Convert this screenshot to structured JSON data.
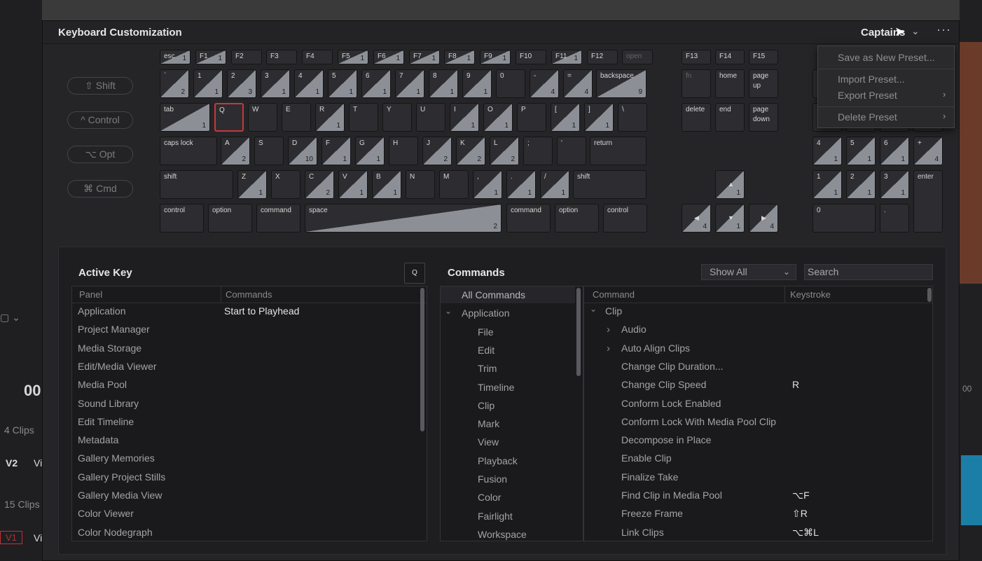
{
  "window": {
    "title": "Keyboard Customization",
    "preset": "Captains",
    "more": "···"
  },
  "modifiers": [
    "⇧ Shift",
    "^ Control",
    "⌥ Opt",
    "⌘ Cmd"
  ],
  "keyboard": {
    "row_fn": [
      {
        "label": "esc",
        "count": "1"
      },
      {
        "label": "F1",
        "count": "1"
      },
      {
        "label": "F2",
        "count": ""
      },
      {
        "label": "F3",
        "count": ""
      },
      {
        "label": "F4",
        "count": ""
      },
      {
        "label": "F5",
        "count": "1"
      },
      {
        "label": "F6",
        "count": "1"
      },
      {
        "label": "F7",
        "count": "1"
      },
      {
        "label": "F8",
        "count": "1"
      },
      {
        "label": "F9",
        "count": "1"
      },
      {
        "label": "F10",
        "count": ""
      },
      {
        "label": "F11",
        "count": "1"
      },
      {
        "label": "F12",
        "count": ""
      },
      {
        "label": "open",
        "count": ""
      }
    ],
    "row_num": [
      {
        "label": "`",
        "count": "2"
      },
      {
        "label": "1",
        "count": "1"
      },
      {
        "label": "2",
        "count": "3"
      },
      {
        "label": "3",
        "count": "1"
      },
      {
        "label": "4",
        "count": "1"
      },
      {
        "label": "5",
        "count": "1"
      },
      {
        "label": "6",
        "count": "1"
      },
      {
        "label": "7",
        "count": "1"
      },
      {
        "label": "8",
        "count": "1"
      },
      {
        "label": "9",
        "count": "1"
      },
      {
        "label": "0",
        "count": ""
      },
      {
        "label": "-",
        "count": "4"
      },
      {
        "label": "=",
        "count": "4"
      },
      {
        "label": "backspace",
        "count": "9"
      }
    ],
    "row_tab": [
      {
        "label": "tab",
        "count": "1"
      },
      {
        "label": "Q",
        "count": ""
      },
      {
        "label": "W",
        "count": ""
      },
      {
        "label": "E",
        "count": ""
      },
      {
        "label": "R",
        "count": "1"
      },
      {
        "label": "T",
        "count": ""
      },
      {
        "label": "Y",
        "count": ""
      },
      {
        "label": "U",
        "count": ""
      },
      {
        "label": "I",
        "count": "1"
      },
      {
        "label": "O",
        "count": "1"
      },
      {
        "label": "P",
        "count": ""
      },
      {
        "label": "[",
        "count": "1"
      },
      {
        "label": "]",
        "count": "1"
      },
      {
        "label": "\\",
        "count": ""
      }
    ],
    "row_caps": [
      {
        "label": "caps lock",
        "count": ""
      },
      {
        "label": "A",
        "count": "2"
      },
      {
        "label": "S",
        "count": ""
      },
      {
        "label": "D",
        "count": "10"
      },
      {
        "label": "F",
        "count": "1"
      },
      {
        "label": "G",
        "count": "1"
      },
      {
        "label": "H",
        "count": ""
      },
      {
        "label": "J",
        "count": "2"
      },
      {
        "label": "K",
        "count": "2"
      },
      {
        "label": "L",
        "count": "2"
      },
      {
        "label": ";",
        "count": ""
      },
      {
        "label": "'",
        "count": ""
      },
      {
        "label": "return",
        "count": ""
      }
    ],
    "row_shift": [
      {
        "label": "shift",
        "count": ""
      },
      {
        "label": "Z",
        "count": "1"
      },
      {
        "label": "X",
        "count": ""
      },
      {
        "label": "C",
        "count": "2"
      },
      {
        "label": "V",
        "count": "1"
      },
      {
        "label": "B",
        "count": "1"
      },
      {
        "label": "N",
        "count": ""
      },
      {
        "label": "M",
        "count": ""
      },
      {
        "label": ",",
        "count": "1"
      },
      {
        "label": ".",
        "count": "1"
      },
      {
        "label": "/",
        "count": "1"
      },
      {
        "label": "shift",
        "count": ""
      }
    ],
    "row_bottom": [
      {
        "label": "control",
        "count": ""
      },
      {
        "label": "option",
        "count": ""
      },
      {
        "label": "command",
        "count": ""
      },
      {
        "label": "space",
        "count": "2"
      },
      {
        "label": "command",
        "count": ""
      },
      {
        "label": "option",
        "count": ""
      },
      {
        "label": "control",
        "count": ""
      }
    ],
    "nav_fn": [
      {
        "label": "F13",
        "count": ""
      },
      {
        "label": "F14",
        "count": ""
      },
      {
        "label": "F15",
        "count": ""
      }
    ],
    "nav_1": [
      {
        "label": "fn",
        "count": ""
      },
      {
        "label": "home",
        "count": ""
      },
      {
        "label": "page up",
        "count": ""
      }
    ],
    "nav_2": [
      {
        "label": "delete",
        "count": ""
      },
      {
        "label": "end",
        "count": ""
      },
      {
        "label": "page down",
        "count": ""
      }
    ],
    "arrows": [
      {
        "label": "▲",
        "count": "1"
      },
      {
        "label": "◀",
        "count": "4"
      },
      {
        "label": "▼",
        "count": "1"
      },
      {
        "label": "▶",
        "count": "4"
      }
    ],
    "numpad_row3": [
      {
        "label": "4",
        "count": "1"
      },
      {
        "label": "5",
        "count": "1"
      },
      {
        "label": "6",
        "count": "1"
      },
      {
        "label": "+",
        "count": "4"
      }
    ],
    "numpad_row4": [
      {
        "label": "1",
        "count": "1"
      },
      {
        "label": "2",
        "count": "1"
      },
      {
        "label": "3",
        "count": "1"
      },
      {
        "label": "enter",
        "count": ""
      }
    ],
    "numpad_row5": [
      {
        "label": "0",
        "count": ""
      },
      {
        "label": ".",
        "count": ""
      }
    ]
  },
  "menu": {
    "items": [
      "Save as New Preset...",
      "Import Preset...",
      "Export Preset",
      "Delete Preset"
    ],
    "arrow": "›"
  },
  "active_key": {
    "title": "Active Key",
    "key": "Q",
    "columns": [
      "Panel",
      "Commands"
    ],
    "rows": [
      {
        "panel": "Application",
        "command": "Start to Playhead"
      },
      {
        "panel": "Project Manager",
        "command": ""
      },
      {
        "panel": "Media Storage",
        "command": ""
      },
      {
        "panel": "Edit/Media Viewer",
        "command": ""
      },
      {
        "panel": "Media Pool",
        "command": ""
      },
      {
        "panel": "Sound Library",
        "command": ""
      },
      {
        "panel": "Edit Timeline",
        "command": ""
      },
      {
        "panel": "Metadata",
        "command": ""
      },
      {
        "panel": "Gallery Memories",
        "command": ""
      },
      {
        "panel": "Gallery Project Stills",
        "command": ""
      },
      {
        "panel": "Gallery Media View",
        "command": ""
      },
      {
        "panel": "Color Viewer",
        "command": ""
      },
      {
        "panel": "Color Nodegraph",
        "command": ""
      }
    ]
  },
  "commands": {
    "title": "Commands",
    "filter": "Show All",
    "search_placeholder": "Search",
    "tree": [
      "All Commands",
      "Application",
      "File",
      "Edit",
      "Trim",
      "Timeline",
      "Clip",
      "Mark",
      "View",
      "Playback",
      "Fusion",
      "Color",
      "Fairlight",
      "Workspace"
    ],
    "columns": [
      "Command",
      "Keystroke"
    ],
    "rows": [
      {
        "name": "Clip",
        "key": ""
      },
      {
        "name": "Audio",
        "key": ""
      },
      {
        "name": "Auto Align Clips",
        "key": ""
      },
      {
        "name": "Change Clip Duration...",
        "key": ""
      },
      {
        "name": "Change Clip Speed",
        "key": "R"
      },
      {
        "name": "Conform Lock Enabled",
        "key": ""
      },
      {
        "name": "Conform Lock With Media Pool Clip",
        "key": ""
      },
      {
        "name": "Decompose in Place",
        "key": ""
      },
      {
        "name": "Enable Clip",
        "key": ""
      },
      {
        "name": "Finalize Take",
        "key": ""
      },
      {
        "name": "Find Clip in Media Pool",
        "key": "⌥F"
      },
      {
        "name": "Freeze Frame",
        "key": "⇧R"
      },
      {
        "name": "Link Clips",
        "key": "⌥⌘L"
      }
    ]
  },
  "background": {
    "clips1": "4 Clips",
    "clips2": "15 Clips",
    "tc": "00",
    "v2": "V2",
    "v1": "V1",
    "vi": "Vi",
    "tc_right": "00"
  }
}
